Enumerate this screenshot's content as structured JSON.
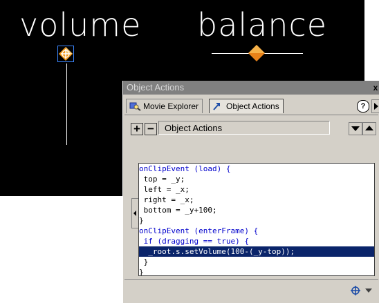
{
  "stage": {
    "volume_label": "volume",
    "balance_label": "balance"
  },
  "panel": {
    "title": "Object Actions",
    "close_label": "x",
    "tabs": [
      {
        "label": "Movie Explorer",
        "icon": "movie-explorer-icon",
        "active": false
      },
      {
        "label": "Object Actions",
        "icon": "arrow-actions-icon",
        "active": true
      }
    ],
    "help_label": "?",
    "toolbar": {
      "add_label": "+",
      "remove_label": "−",
      "actions_label": "Object Actions"
    },
    "code_lines": [
      {
        "text": "onClipEvent (load) {",
        "kind": "keyword"
      },
      {
        "text": " top = _y;",
        "kind": "normal"
      },
      {
        "text": " left = _x;",
        "kind": "normal"
      },
      {
        "text": " right = _x;",
        "kind": "normal"
      },
      {
        "text": " bottom = _y+100;",
        "kind": "normal"
      },
      {
        "text": "}",
        "kind": "normal"
      },
      {
        "text": "onClipEvent (enterFrame) {",
        "kind": "keyword"
      },
      {
        "text": " if (dragging == true) {",
        "kind": "keyword"
      },
      {
        "text": "  _root.s.setVolume(100-(_y-top));",
        "kind": "selected"
      },
      {
        "text": " }",
        "kind": "normal"
      },
      {
        "text": "}",
        "kind": "normal"
      }
    ]
  },
  "colors": {
    "stage_background": "#000000",
    "selection": "#0a246a",
    "keyword": "#0000cc",
    "knob_orange": "#f39a1c"
  }
}
